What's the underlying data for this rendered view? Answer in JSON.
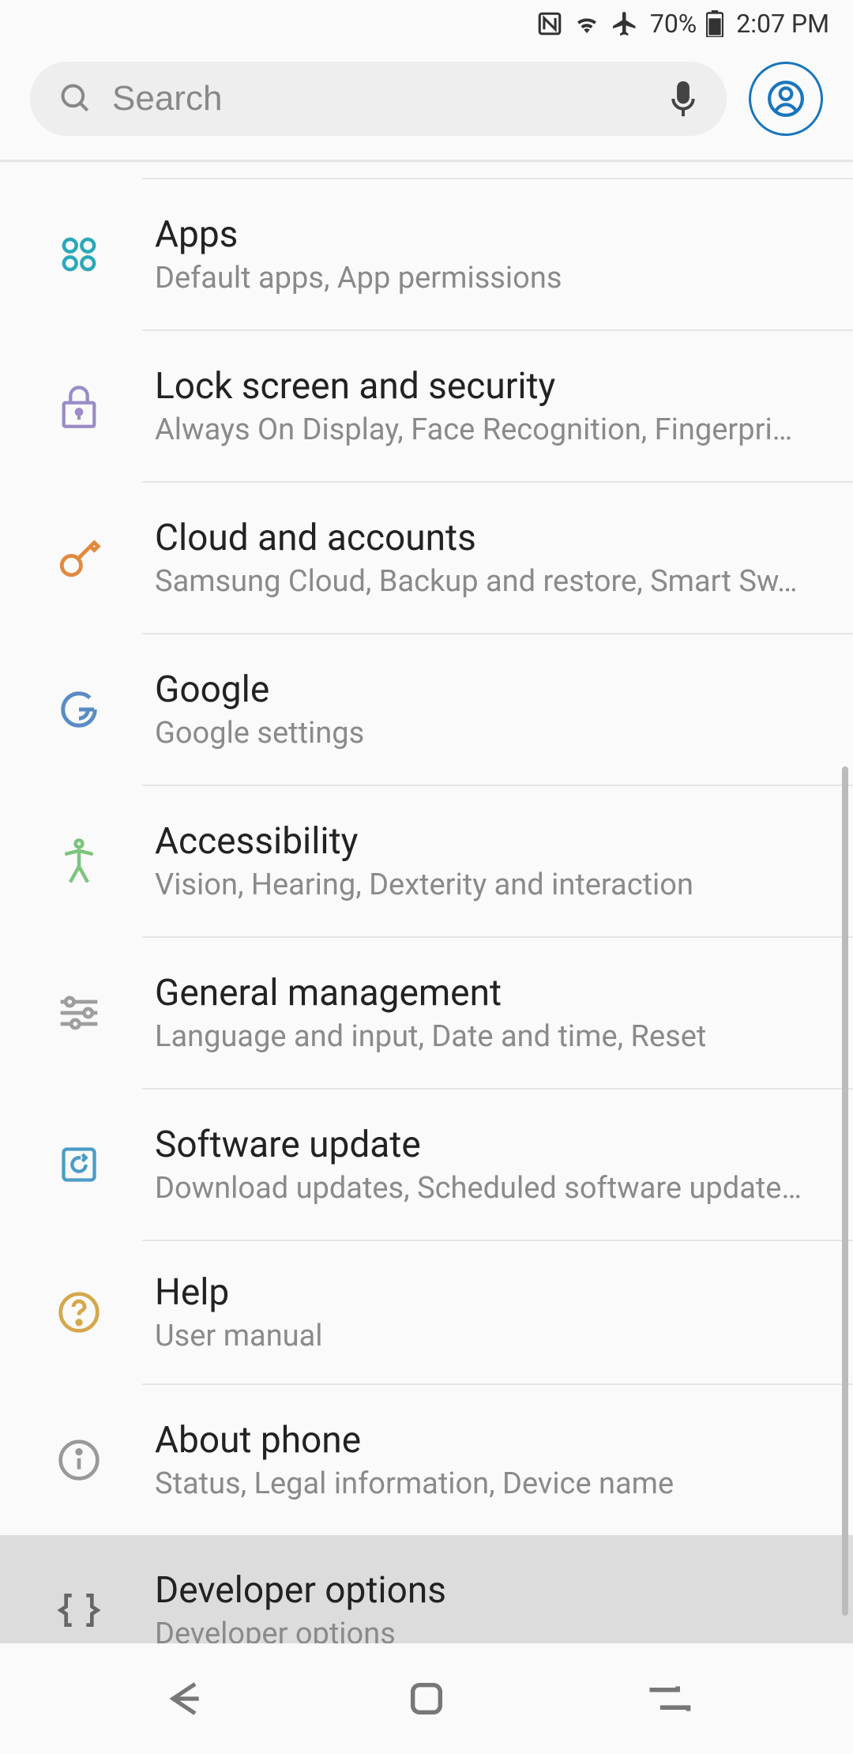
{
  "status_bar": {
    "nfc_icon": "nfc",
    "wifi_icon": "wifi",
    "airplane_icon": "airplane",
    "battery_percent": "70%",
    "time": "2:07 PM"
  },
  "search": {
    "placeholder": "Search"
  },
  "settings": [
    {
      "id": "apps",
      "title": "Apps",
      "subtitle": "Default apps, App permissions",
      "icon_color": "#2196a6"
    },
    {
      "id": "lock-screen",
      "title": "Lock screen and security",
      "subtitle": "Always On Display, Face Recognition, Fingerpri…",
      "icon_color": "#9a8cc7"
    },
    {
      "id": "cloud-accounts",
      "title": "Cloud and accounts",
      "subtitle": "Samsung Cloud, Backup and restore, Smart Sw…",
      "icon_color": "#e08a3e"
    },
    {
      "id": "google",
      "title": "Google",
      "subtitle": "Google settings",
      "icon_color": "#5a8cc4"
    },
    {
      "id": "accessibility",
      "title": "Accessibility",
      "subtitle": "Vision, Hearing, Dexterity and interaction",
      "icon_color": "#7cc47c"
    },
    {
      "id": "general-management",
      "title": "General management",
      "subtitle": "Language and input, Date and time, Reset",
      "icon_color": "#9e9e9e"
    },
    {
      "id": "software-update",
      "title": "Software update",
      "subtitle": "Download updates, Scheduled software update…",
      "icon_color": "#4a9cc7"
    },
    {
      "id": "help",
      "title": "Help",
      "subtitle": "User manual",
      "icon_color": "#d4a84a"
    },
    {
      "id": "about-phone",
      "title": "About phone",
      "subtitle": "Status, Legal information, Device name",
      "icon_color": "#999"
    },
    {
      "id": "developer-options",
      "title": "Developer options",
      "subtitle": "Developer options",
      "icon_color": "#666",
      "pressed": true
    }
  ]
}
